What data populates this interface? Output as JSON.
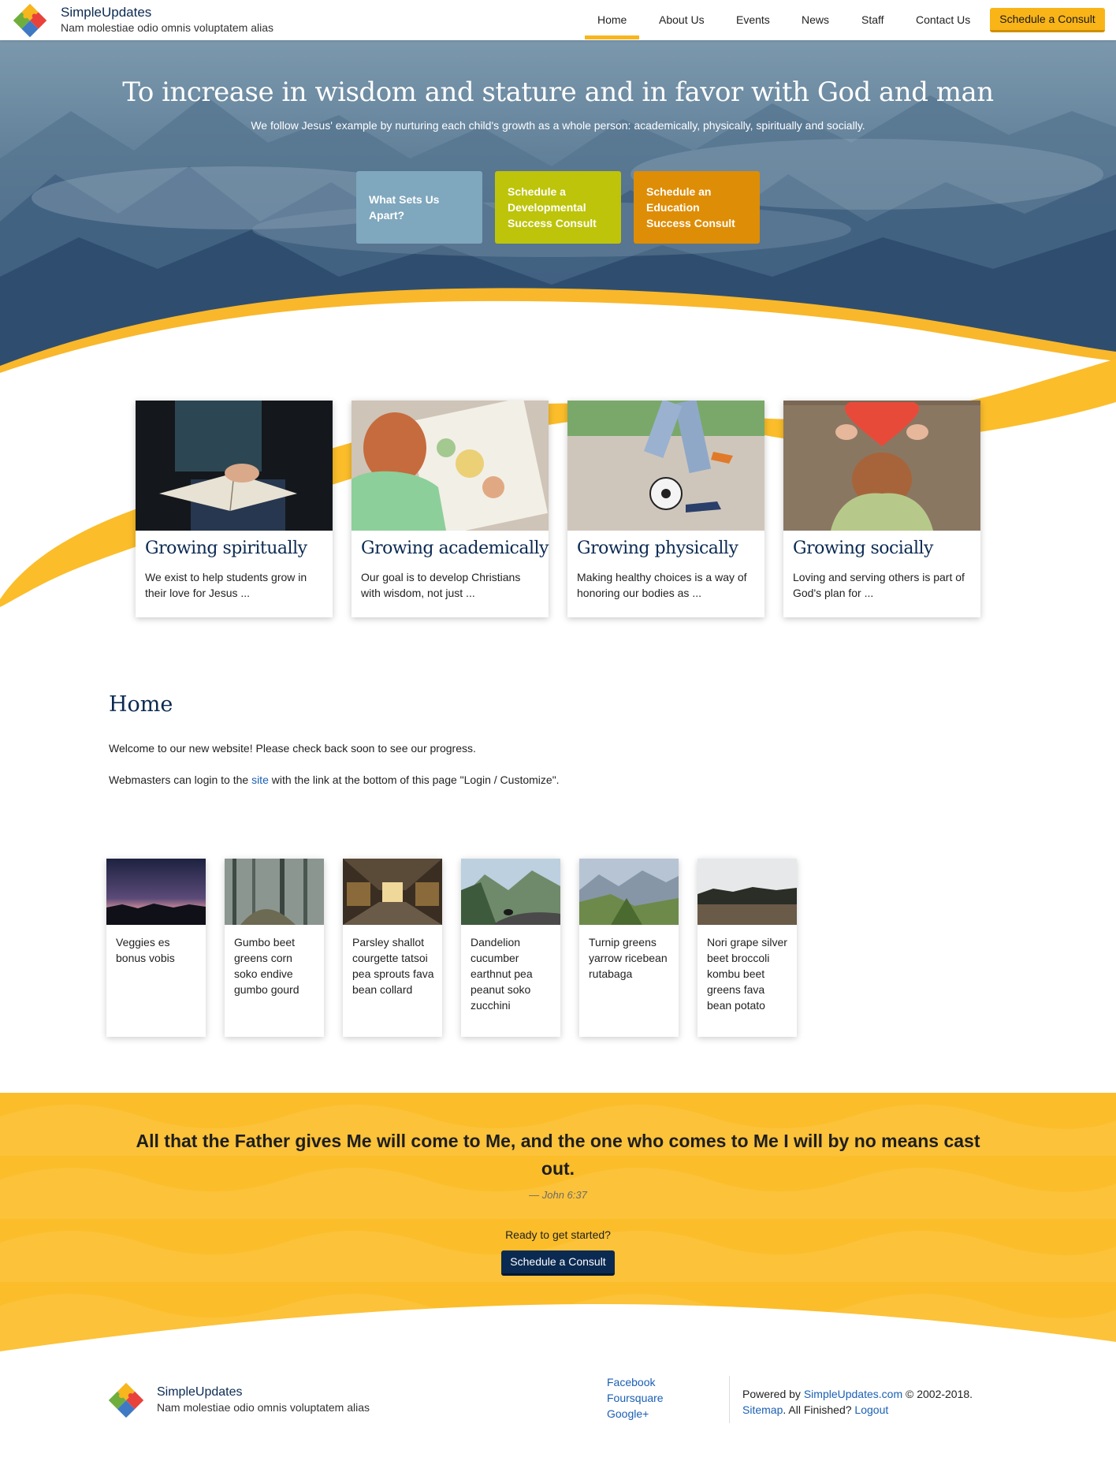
{
  "header": {
    "brand_name": "SimpleUpdates",
    "brand_tagline": "Nam molestiae odio omnis voluptatem alias",
    "nav": [
      "Home",
      "About Us",
      "Events",
      "News",
      "Staff",
      "Contact Us"
    ],
    "active_nav": "Home",
    "cta_label": "Schedule a Consult"
  },
  "hero": {
    "title": "To increase in wisdom and stature and in favor with God and man",
    "subtitle": "We follow Jesus' example by nurturing each child's growth as a whole person: academically, physically, spiritually and socially.",
    "buttons": [
      {
        "label": "What Sets Us Apart?",
        "color": "#7fa7bd"
      },
      {
        "label": "Schedule a Developmental Success Consult",
        "color": "#bdc40a"
      },
      {
        "label": "Schedule an Education Success Consult",
        "color": "#de8d06"
      }
    ]
  },
  "features": [
    {
      "title": "Growing spiritually",
      "text": "We exist to help students grow in their love for Jesus ...",
      "image": "child-reading-bible"
    },
    {
      "title": "Growing academically",
      "text": "Our goal is to develop Christians with wisdom, not just ...",
      "image": "child-reading-map"
    },
    {
      "title": "Growing physically",
      "text": "Making healthy choices is a way of honoring our bodies as ...",
      "image": "kicking-soccer-ball"
    },
    {
      "title": "Growing socially",
      "text": "Loving and serving others is part of God's plan for ...",
      "image": "child-with-paper-heart"
    }
  ],
  "content": {
    "title": "Home",
    "welcome": "Welcome to our new website! Please check back soon to see our progress.",
    "login_before": "Webmasters can login to the ",
    "login_link": "site",
    "login_after": " with the link at the bottom of this page \"Login / Customize\"."
  },
  "cards": [
    {
      "text": "Veggies es bonus vobis",
      "image": "dusk-mountain-silhouette"
    },
    {
      "text": "Gumbo beet greens corn soko endive gumbo gourd",
      "image": "misty-forest-path"
    },
    {
      "text": "Parsley shallot courgette tatsoi pea sprouts fava bean collard",
      "image": "train-interior"
    },
    {
      "text": "Dandelion cucumber earthnut pea peanut soko zucchini",
      "image": "mountain-road-tunnel"
    },
    {
      "text": "Turnip greens yarrow ricebean rutabaga",
      "image": "green-mountain-ridges"
    },
    {
      "text": "Nori grape silver beet broccoli kombu beet greens fava bean potato",
      "image": "dark-treeline-field"
    }
  ],
  "quote": {
    "text": "All that the Father gives Me will come to Me, and the one who comes to Me I will by no means cast out.",
    "cite": "— John 6:37",
    "ready": "Ready to get started?",
    "button": "Schedule a Consult"
  },
  "footer": {
    "brand_name": "SimpleUpdates",
    "brand_tagline": "Nam molestiae odio omnis voluptatem alias",
    "social": [
      "Facebook",
      "Foursquare",
      "Google+"
    ],
    "powered_prefix": "Powered by ",
    "powered_link": "SimpleUpdates.com",
    "copyright": " © 2002-2018.",
    "sitemap": "Sitemap",
    "finished": ". All Finished? ",
    "logout": "Logout"
  },
  "colors": {
    "accent": "#f7b51e",
    "navy": "#0b2a52",
    "link": "#1a5fb4"
  }
}
